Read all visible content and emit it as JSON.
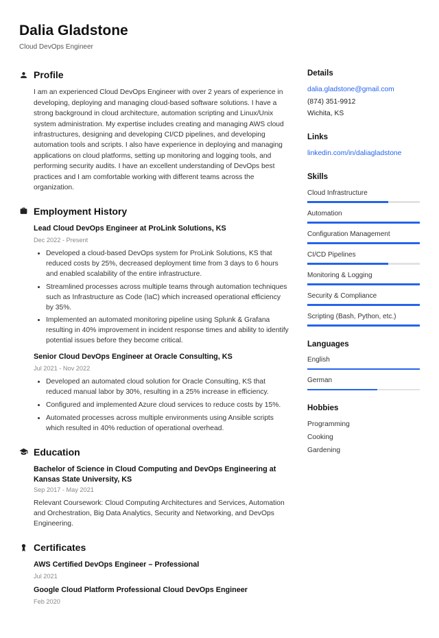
{
  "name": "Dalia Gladstone",
  "title": "Cloud DevOps Engineer",
  "sections": {
    "profile": "Profile",
    "employment": "Employment History",
    "education": "Education",
    "certificates": "Certificates"
  },
  "profile": "I am an experienced Cloud DevOps Engineer with over 2 years of experience in developing, deploying and managing cloud-based software solutions. I have a strong background in cloud architecture, automation scripting and Linux/Unix system administration. My expertise includes creating and managing AWS cloud infrastructures, designing and developing CI/CD pipelines, and developing automation tools and scripts. I also have experience in deploying and managing applications on cloud platforms, setting up monitoring and logging tools, and performing security audits. I have an excellent understanding of DevOps best practices and I am comfortable working with different teams across the organization.",
  "jobs": [
    {
      "title": "Lead Cloud DevOps Engineer at ProLink Solutions, KS",
      "date": "Dec 2022 - Present",
      "bullets": [
        "Developed a cloud-based DevOps system for ProLink Solutions, KS that reduced costs by 25%, decreased deployment time from 3 days to 6 hours and enabled scalability of the entire infrastructure.",
        "Streamlined processes across multiple teams through automation techniques such as Infrastructure as Code (IaC) which increased operational efficiency by 35%.",
        "Implemented an automated monitoring pipeline using Splunk & Grafana resulting in 40% improvement in incident response times and ability to identify potential issues before they become critical."
      ]
    },
    {
      "title": "Senior Cloud DevOps Engineer at Oracle Consulting, KS",
      "date": "Jul 2021 - Nov 2022",
      "bullets": [
        "Developed an automated cloud solution for Oracle Consulting, KS that reduced manual labor by 30%, resulting in a 25% increase in efficiency.",
        "Configured and implemented Azure cloud services to reduce costs by 15%.",
        "Automated processes across multiple environments using Ansible scripts which resulted in 40% reduction of operational overhead."
      ]
    }
  ],
  "education": {
    "title": "Bachelor of Science in Cloud Computing and DevOps Engineering at Kansas State University, KS",
    "date": "Sep 2017 - May 2021",
    "text": "Relevant Coursework: Cloud Computing Architectures and Services, Automation and Orchestration, Big Data Analytics, Security and Networking, and DevOps Engineering."
  },
  "certificates": [
    {
      "title": "AWS Certified DevOps Engineer – Professional",
      "date": "Jul 2021"
    },
    {
      "title": "Google Cloud Platform Professional Cloud DevOps Engineer",
      "date": "Feb 2020"
    }
  ],
  "details": {
    "heading": "Details",
    "email": "dalia.gladstone@gmail.com",
    "phone": "(874) 351-9912",
    "location": "Wichita, KS"
  },
  "links": {
    "heading": "Links",
    "linkedin": "linkedin.com/in/daliagladstone"
  },
  "skills": {
    "heading": "Skills",
    "items": [
      {
        "name": "Cloud Infrastructure",
        "level": 72
      },
      {
        "name": "Automation",
        "level": 100
      },
      {
        "name": "Configuration Management",
        "level": 100
      },
      {
        "name": "CI/CD Pipelines",
        "level": 72
      },
      {
        "name": "Monitoring & Logging",
        "level": 100
      },
      {
        "name": "Security & Compliance",
        "level": 100
      },
      {
        "name": "Scripting (Bash, Python, etc.)",
        "level": 100
      }
    ]
  },
  "languages": {
    "heading": "Languages",
    "items": [
      {
        "name": "English",
        "level": 100
      },
      {
        "name": "German",
        "level": 62
      }
    ]
  },
  "hobbies": {
    "heading": "Hobbies",
    "items": [
      "Programming",
      "Cooking",
      "Gardening"
    ]
  }
}
